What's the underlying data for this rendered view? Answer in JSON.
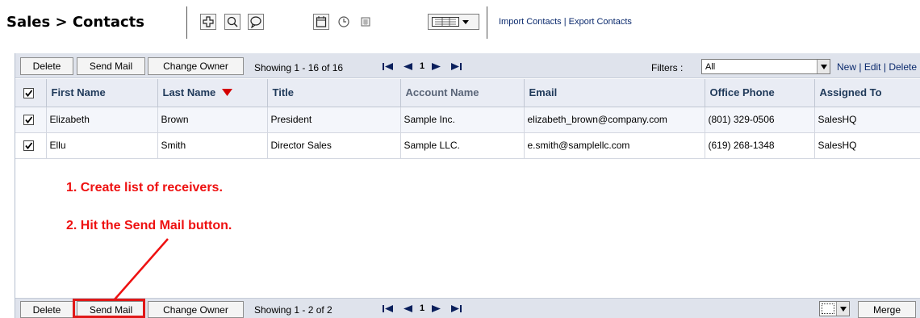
{
  "header": {
    "title": "Sales > Contacts",
    "links": {
      "import": "Import Contacts",
      "sep": "|",
      "export": "Export Contacts"
    },
    "toolbar_icons": [
      "add-icon",
      "search-icon",
      "chat-bubble-icon",
      "calendar-icon",
      "clock-icon",
      "calculator-icon",
      "column-view-icon"
    ]
  },
  "top_bar": {
    "delete": "Delete",
    "send_mail": "Send Mail",
    "change_owner": "Change Owner",
    "showing": "Showing 1 - 16 of 16",
    "page": "1",
    "filters_label": "Filters :",
    "filter_value": "All",
    "filter_links": {
      "new": "New",
      "edit": "Edit",
      "delete": "Delete",
      "sep": "|"
    }
  },
  "table": {
    "columns": [
      "First Name",
      "Last Name",
      "Title",
      "Account Name",
      "Email",
      "Office Phone",
      "Assigned To"
    ],
    "sort_column": "Last Name",
    "rows": [
      {
        "first": "Elizabeth",
        "last": "Brown",
        "title": "President",
        "account": "Sample Inc.",
        "email": "elizabeth_brown@company.com",
        "phone": "(801) 329-0506",
        "assigned": "SalesHQ",
        "checked": true
      },
      {
        "first": "Ellu",
        "last": "Smith",
        "title": "Director Sales",
        "account": "Sample LLC.",
        "email": "e.smith@samplellc.com",
        "phone": "(619) 268-1348",
        "assigned": "SalesHQ",
        "checked": true
      }
    ]
  },
  "instructions": {
    "step1": "1. Create list of receivers.",
    "step2": "2. Hit the Send Mail button."
  },
  "bottom_bar": {
    "delete": "Delete",
    "send_mail": "Send Mail",
    "change_owner": "Change Owner",
    "showing": "Showing 1 - 2 of 2",
    "page": "1",
    "merge": "Merge"
  },
  "colors": {
    "annotation": "#ee1111",
    "link": "#0b2a6d",
    "toolbar_bg": "#dfe3ec",
    "sort_arrow": "#d40000"
  }
}
